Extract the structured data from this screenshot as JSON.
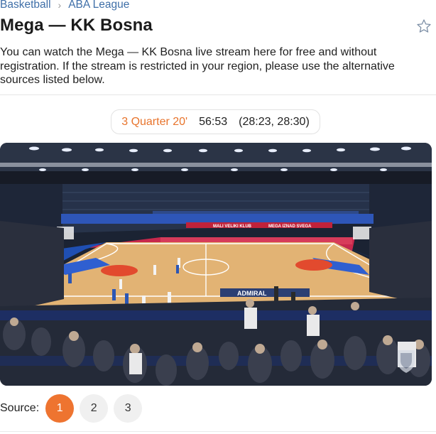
{
  "breadcrumb": {
    "sport": "Basketball",
    "league": "ABA League",
    "separator": "›"
  },
  "match": {
    "title": "Mega — KK Bosna"
  },
  "description": "You can watch the Mega — KK Bosna live stream here for free and without registration. If the stream is restricted in your region, please use the alternative sources listed below.",
  "score": {
    "period": "3 Quarter 20'",
    "total": "56:53",
    "quarters": "(28:23, 28:30)"
  },
  "video": {
    "banner_left": "MALI VELIKI KLUB",
    "banner_right": "MEGA IZNAD SVEGA",
    "court_logo": "ADMIRAL"
  },
  "sources": {
    "label": "Source:",
    "options": [
      "1",
      "2",
      "3"
    ],
    "active": "1"
  },
  "colors": {
    "accent": "#ee7430",
    "link": "#3f6fa8",
    "star": "#7d8fa6"
  },
  "icons": {
    "favorite": "star-icon",
    "watermark": "shield-icon"
  }
}
